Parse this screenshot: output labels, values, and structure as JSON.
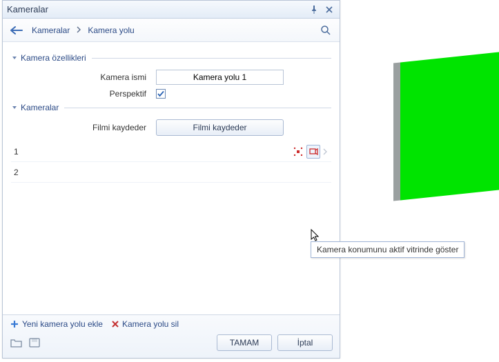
{
  "titlebar": {
    "title": "Kameralar"
  },
  "breadcrumb": {
    "items": [
      "Kameralar",
      "Kamera yolu"
    ]
  },
  "sections": {
    "props": {
      "title": "Kamera özellikleri"
    },
    "cams": {
      "title": "Kameralar"
    }
  },
  "form": {
    "name_label": "Kamera ismi",
    "name_value": "Kamera yolu 1",
    "perspective_label": "Perspektif",
    "perspective_checked": true,
    "record_label": "Filmi kaydeder",
    "record_button": "Filmi kaydeder"
  },
  "list": {
    "rows": [
      {
        "idx": "1"
      },
      {
        "idx": "2"
      }
    ]
  },
  "tooltip": "Kamera konumunu aktif vitrinde göster",
  "footer": {
    "add_label": "Yeni kamera yolu ekle",
    "delete_label": "Kamera yolu sil",
    "ok": "TAMAM",
    "cancel": "İptal"
  }
}
